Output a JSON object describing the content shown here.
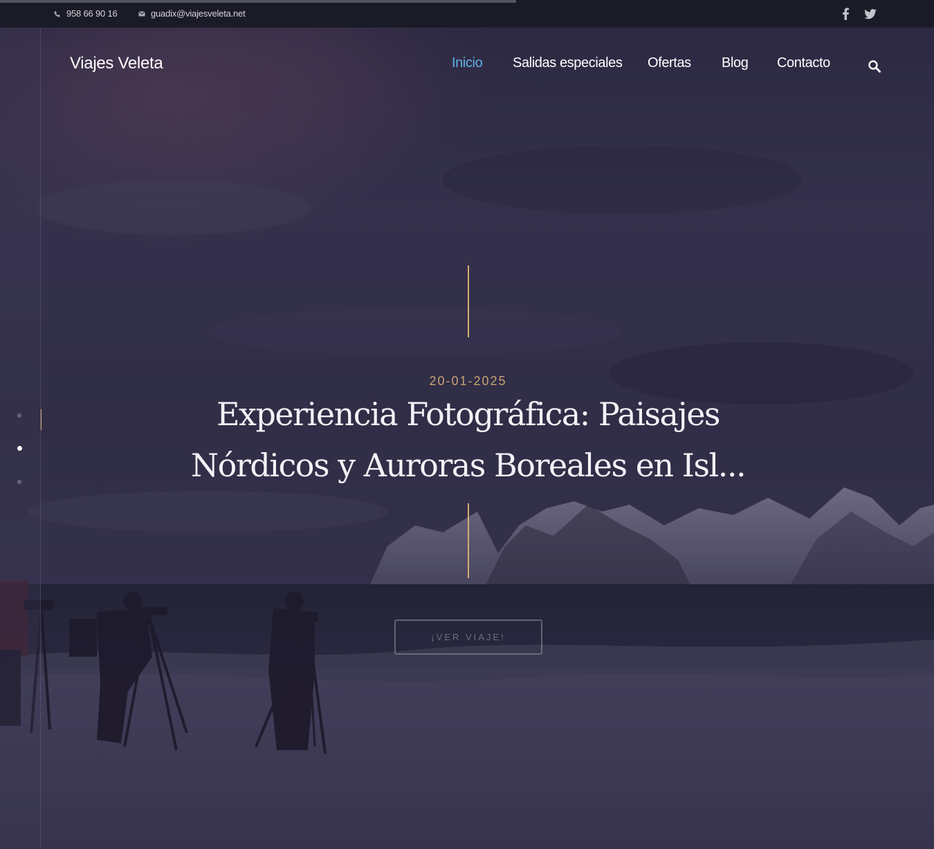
{
  "topbar": {
    "phone": "958 66 90 16",
    "email": "guadix@viajesveleta.net",
    "phone_icon": "phone-icon",
    "email_icon": "envelope-icon",
    "social": [
      "facebook-icon",
      "twitter-icon"
    ]
  },
  "header": {
    "brand": "Viajes Veleta",
    "nav": [
      {
        "label": "Inicio",
        "active": true
      },
      {
        "label": "Salidas especiales",
        "active": false
      },
      {
        "label": "Ofertas",
        "active": false
      },
      {
        "label": "Blog",
        "active": false
      },
      {
        "label": "Contacto",
        "active": false
      }
    ],
    "search_icon": "search-icon"
  },
  "slider": {
    "slides_count": 3,
    "active_slide": 2
  },
  "hero": {
    "date": "20-01-2025",
    "title": "Experiencia Fotográfica: Paisajes Nórdicos y Auroras Boreales en Isl...",
    "cta_label": "¡VER VIAJE!"
  },
  "colors": {
    "accent_gold": "#d5ad76",
    "nav_active": "#5fb0e8",
    "topbar_bg": "#1b1b28"
  }
}
